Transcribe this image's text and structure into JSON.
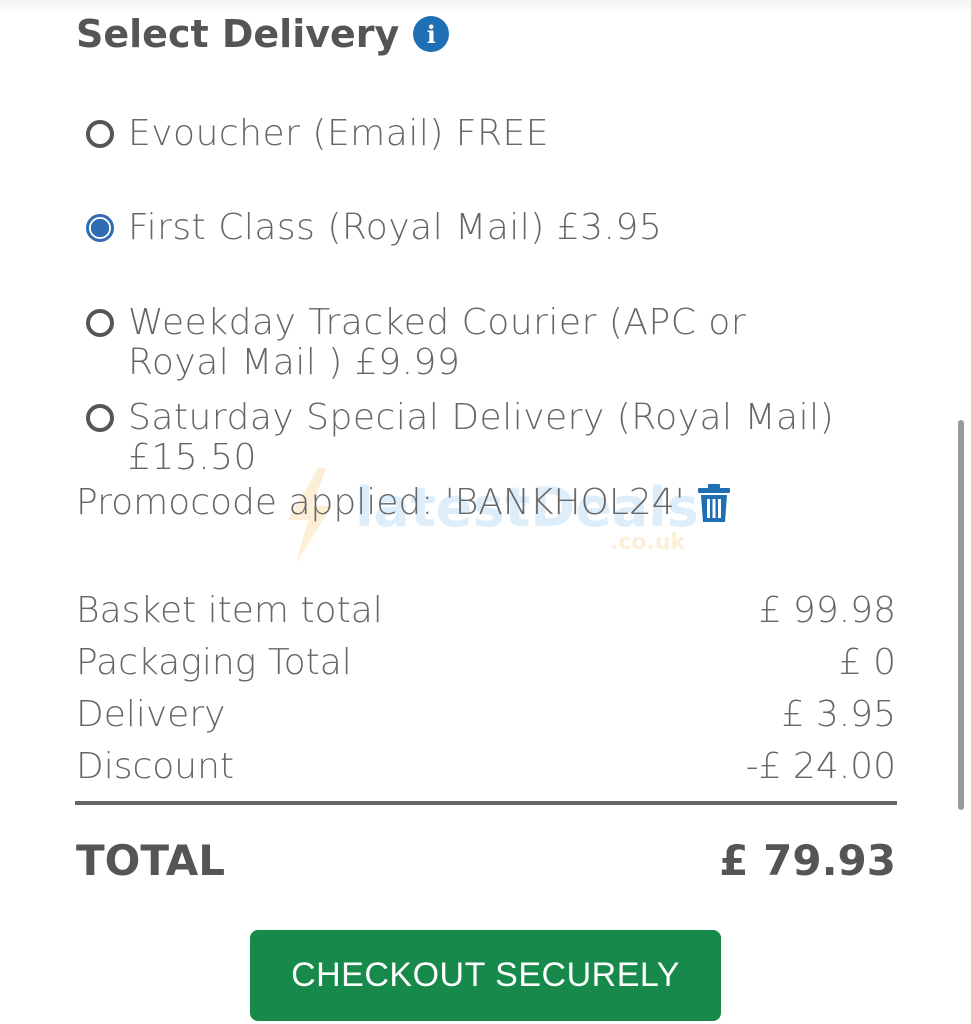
{
  "delivery": {
    "heading": "Select Delivery",
    "info_icon_glyph": "i",
    "options": [
      {
        "label": "Evoucher (Email) FREE",
        "selected": false
      },
      {
        "label": "First Class (Royal Mail) £3.95",
        "selected": true
      },
      {
        "label": "Weekday Tracked Courier (APC or Royal Mail ) £9.99",
        "selected": false
      },
      {
        "label": "Saturday Special Delivery (Royal Mail) £15.50",
        "selected": false
      }
    ]
  },
  "promo": {
    "text": "Promocode applied: 'BANKHOL24'",
    "remove_icon": "trash-icon"
  },
  "watermark": {
    "text": "latestDeals",
    "sub": ".co.uk"
  },
  "summary": {
    "rows": [
      {
        "label": "Basket item total",
        "value": "£ 99.98"
      },
      {
        "label": "Packaging Total",
        "value": "£ 0"
      },
      {
        "label": "Delivery",
        "value": "£ 3.95"
      },
      {
        "label": "Discount",
        "value": "-£ 24.00"
      }
    ],
    "total_label": "TOTAL",
    "total_value": "£ 79.93"
  },
  "checkout": {
    "label": "CHECKOUT SECURELY"
  },
  "colors": {
    "accent_blue": "#1f6fb5",
    "checkout_green": "#17894a",
    "text_gray": "#666666"
  }
}
